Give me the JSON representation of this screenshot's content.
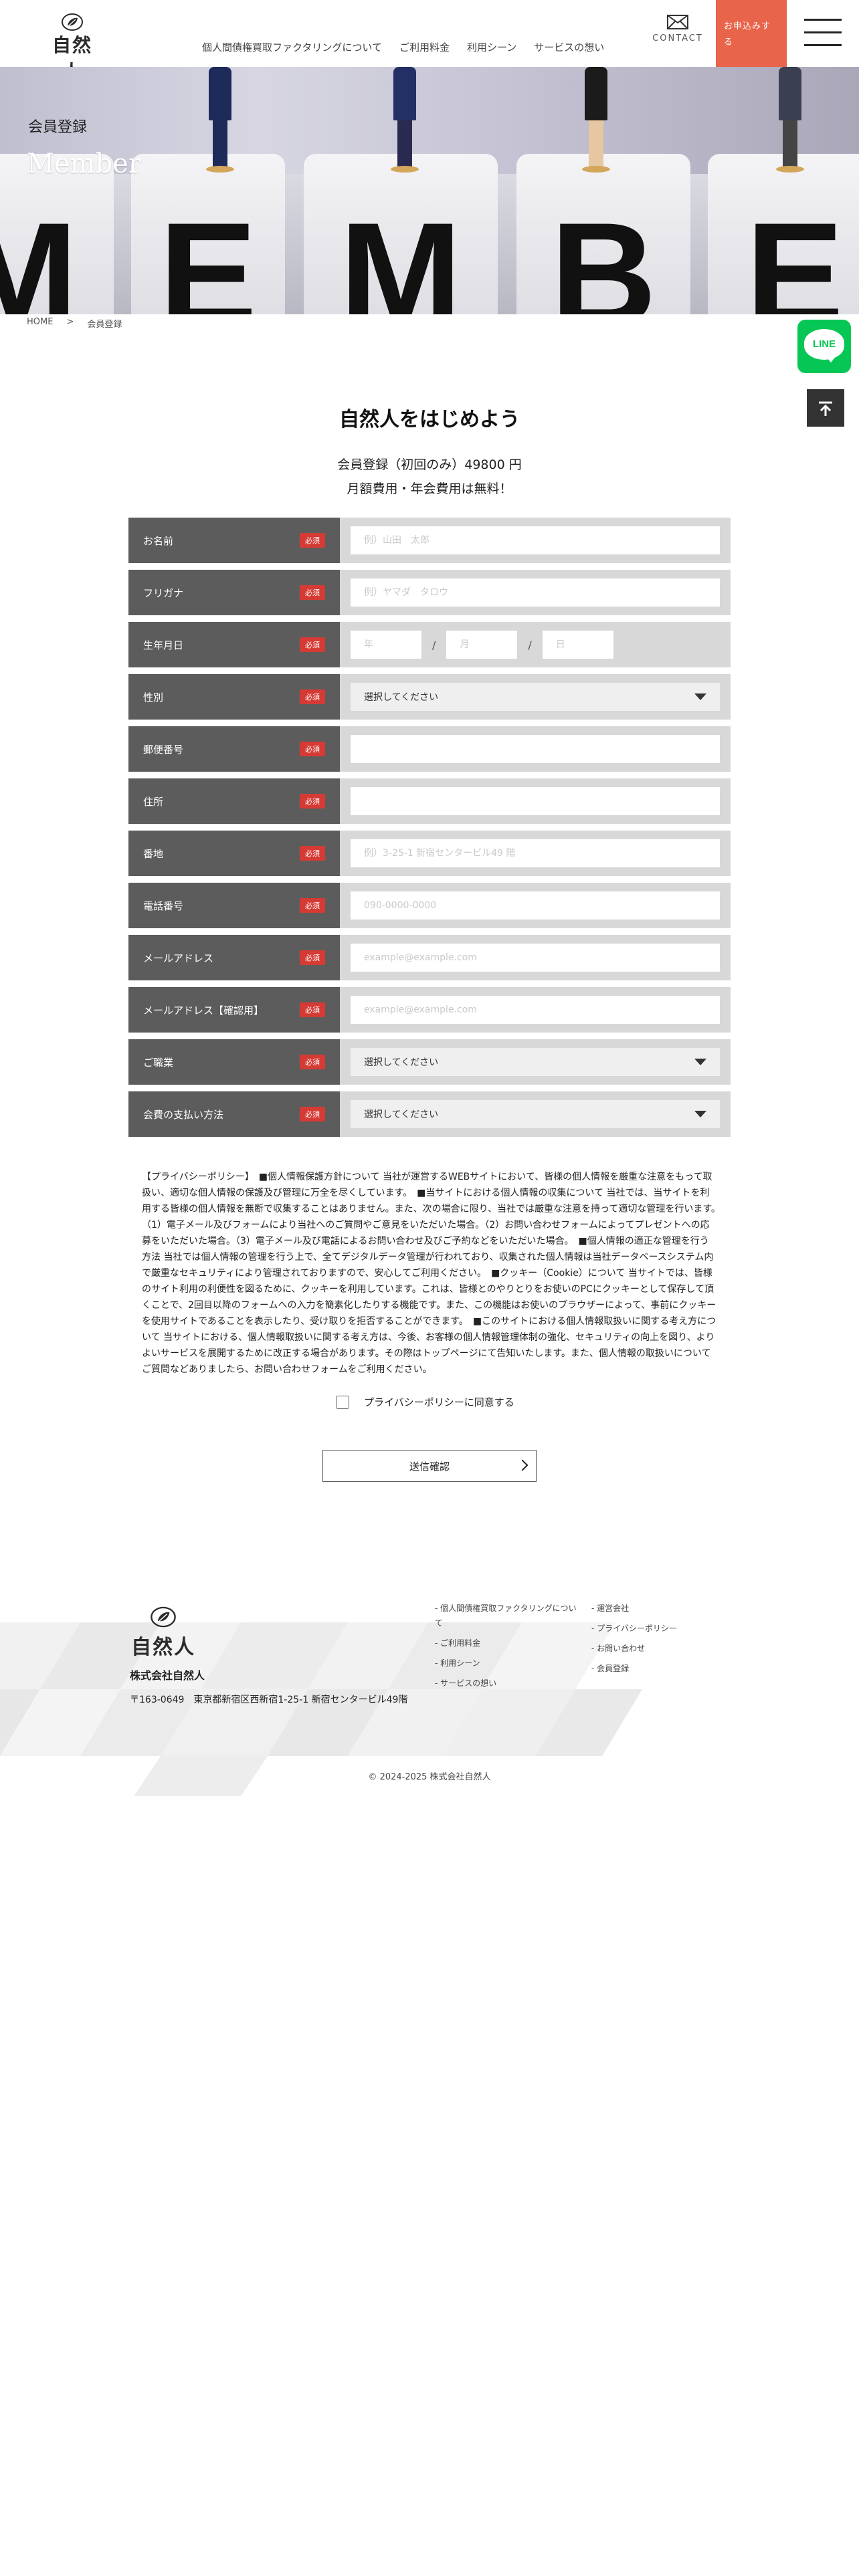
{
  "header": {
    "logo_text": "自然人",
    "nav": [
      "個人間債権買取ファクタリングについて",
      "ご利用料金",
      "利用シーン",
      "サービスの想い"
    ],
    "contact_label": "CONTACT",
    "apply_label": "お申込みする"
  },
  "hero": {
    "subtitle": "会員登録",
    "title": "Member",
    "letters": [
      "M",
      "E",
      "M",
      "B",
      "E"
    ]
  },
  "breadcrumb": {
    "home": "HOME",
    "separator": ">",
    "current": "会員登録"
  },
  "side": {
    "line_label": "LINE"
  },
  "intro": {
    "title": "自然人をはじめよう",
    "line1": "会員登録（初回のみ）49800 円",
    "line2": "月額費用・年会費用は無料！"
  },
  "form": {
    "required_label": "必須",
    "fields": {
      "name": {
        "label": "お名前",
        "placeholder": "例）山田　太郎"
      },
      "kana": {
        "label": "フリガナ",
        "placeholder": "例）ヤマダ　タロウ"
      },
      "dob": {
        "label": "生年月日",
        "year": "年",
        "month": "月",
        "day": "日",
        "sep": "/"
      },
      "gender": {
        "label": "性別",
        "value": "選択してください"
      },
      "postal": {
        "label": "郵便番号",
        "placeholder": ""
      },
      "address": {
        "label": "住所",
        "placeholder": ""
      },
      "block": {
        "label": "番地",
        "placeholder": "例）3-25-1 新宿センタービル49 階"
      },
      "phone": {
        "label": "電話番号",
        "placeholder": "090-0000-0000"
      },
      "email": {
        "label": "メールアドレス",
        "placeholder": "example@example.com"
      },
      "email_confirm": {
        "label": "メールアドレス【確認用】",
        "placeholder": "example@example.com"
      },
      "job": {
        "label": "ご職業",
        "value": "選択してください"
      },
      "payment": {
        "label": "会費の支払い方法",
        "value": "選択してください"
      }
    }
  },
  "privacy": {
    "text": "【プライバシーポリシー】　■個人情報保護方針について 当社が運営するWEBサイトにおいて、皆様の個人情報を厳重な注意をもって取扱い、適切な個人情報の保護及び管理に万全を尽くしています。　■当サイトにおける個人情報の収集について 当社では、当サイトを利用する皆様の個人情報を無断で収集することはありません。また、次の場合に限り、当社では厳重な注意を持って適切な管理を行います。　（1）電子メール及びフォームにより当社へのご質問やご意見をいただいた場合。（2）お問い合わせフォームによってプレゼントへの応募をいただいた場合。（3）電子メール及び電話によるお問い合わせ及びご予約などをいただいた場合。　■個人情報の適正な管理を行う方法 当社では個人情報の管理を行う上で、全てデジタルデータ管理が行われており、収集された個人情報は当社データベースシステム内で厳重なセキュリティにより管理されておりますので、安心してご利用ください。　■クッキー（Cookie）について 当サイトでは、皆様のサイト利用の利便性を図るために、クッキーを利用しています。これは、皆様とのやりとりをお使いのPCにクッキーとして保存して頂くことで、2回目以降のフォームへの入力を簡素化したりする機能です。また、この機能はお使いのブラウザーによって、事前にクッキーを使用サイトであることを表示したり、受け取りを拒否することができます。　■このサイトにおける個人情報取扱いに関する考え方について 当サイトにおける、個人情報取扱いに関する考え方は、今後、お客様の個人情報管理体制の強化、セキュリティの向上を図り、よりよいサービスを展開するために改正する場合があります。その際はトップページにて告知いたします。また、個人情報の取扱いについてご質問などありましたら、お問い合わせフォームをご利用ください。",
    "agree_label": "プライバシーポリシーに同意する",
    "submit_label": "送信確認"
  },
  "footer": {
    "logo_text": "自然人",
    "company": "株式会社自然人",
    "address": "〒163-0649　東京都新宿区西新宿1-25-1 新宿センタービル49階",
    "nav1": [
      "個人間債権買取ファクタリングについて",
      "ご利用料金",
      "利用シーン",
      "サービスの想い"
    ],
    "nav2": [
      "運営会社",
      "プライバシーポリシー",
      "お問い合わせ",
      "会員登録"
    ],
    "copyright": "© 2024-2025 株式会社自然人"
  },
  "colors": {
    "accent_apply": "#e8644b",
    "label_bg": "#5c5c5c",
    "required": "#d53b34",
    "line_green": "#06c755"
  }
}
